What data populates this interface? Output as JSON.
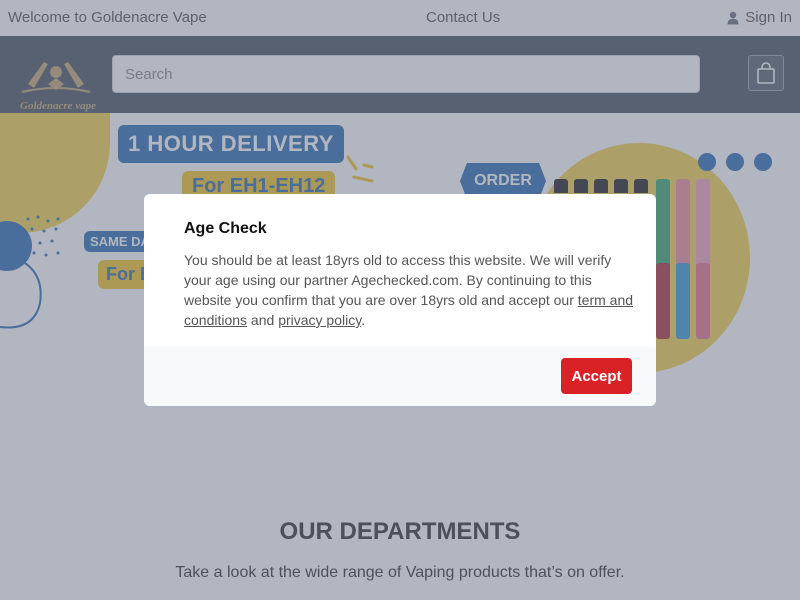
{
  "topbar": {
    "welcome": "Welcome to Goldenacre Vape",
    "contact": "Contact Us",
    "signin": "Sign In",
    "signin_icon": "user-icon"
  },
  "header": {
    "logo_text": "Goldenacre vape",
    "search_placeholder": "Search",
    "cart_icon": "shopping-bag-icon"
  },
  "hero": {
    "delivery": "1 HOUR DELIVERY",
    "eh": "For EH1-EH12",
    "same_day": "SAME DA",
    "for_partial": "For E",
    "order": "ORDER",
    "colors": {
      "blue": "#2e6eb6",
      "yellow": "#f6d14e"
    }
  },
  "departments": {
    "title": "OUR DEPARTMENTS",
    "subtitle": "Take a look at the wide range of Vaping products that’s on offer."
  },
  "modal": {
    "title": "Age Check",
    "body_text": "You should be at least 18yrs old to access this website. We will verify your age using our partner Agechecked.com. By continuing to this website you confirm that you are over 18yrs old and accept our ",
    "terms_link": "term and conditions",
    "and_text": " and ",
    "privacy_link": "privacy policy",
    "period": ".",
    "accept_label": "Accept",
    "accent_color": "#d92226"
  }
}
